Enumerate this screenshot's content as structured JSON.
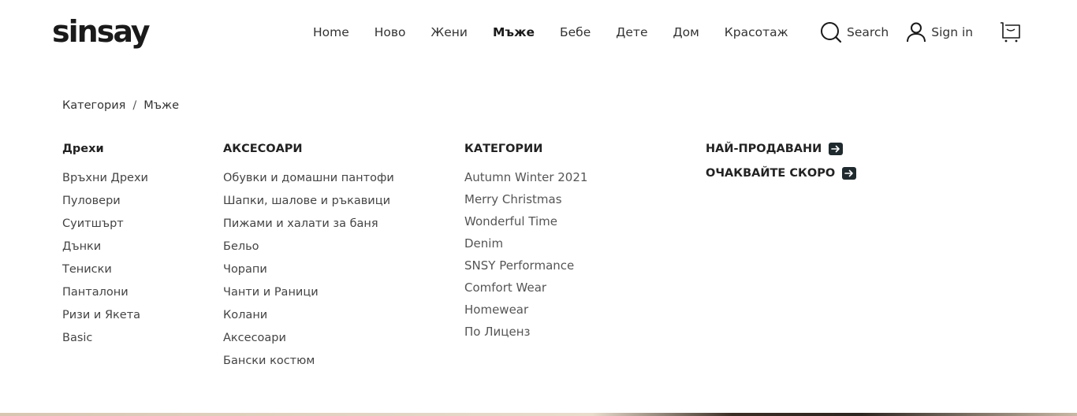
{
  "header": {
    "logo": "sinsay",
    "nav": [
      {
        "label": "Home",
        "active": false
      },
      {
        "label": "Ново",
        "active": false
      },
      {
        "label": "Жени",
        "active": false
      },
      {
        "label": "Мъже",
        "active": true
      },
      {
        "label": "Бебе",
        "active": false
      },
      {
        "label": "Дете",
        "active": false
      },
      {
        "label": "Дом",
        "active": false
      },
      {
        "label": "Красотаж",
        "active": false
      }
    ],
    "search_label": "Search",
    "signin_label": "Sign in"
  },
  "breadcrumb": {
    "root": "Категория",
    "separator": "/",
    "current": "Мъже"
  },
  "menu": {
    "clothes": {
      "title": "Дрехи",
      "items": [
        "Връхни Дрехи",
        "Пуловери",
        "Суитшърт",
        "Дънки",
        "Тениски",
        "Панталони",
        "Ризи и Якета",
        "Basic"
      ]
    },
    "accessories": {
      "title": "АКСЕСОАРИ",
      "items": [
        "Обувки и домашни пантофи",
        "Шапки, шалове и ръкавици",
        "Пижами и халати за баня",
        "Бельо",
        "Чорапи",
        "Чанти и Раници",
        "Колани",
        "Аксесоари",
        "Бански костюм"
      ]
    },
    "categories": {
      "title": "КАТЕГОРИИ",
      "items": [
        "Autumn Winter 2021",
        "Merry Christmas",
        "Wonderful Time",
        "Denim",
        "SNSY Performance",
        "Comfort Wear",
        "Homewear",
        "По Лиценз"
      ]
    },
    "promos": [
      "НАЙ-ПРОДАВАНИ",
      "ОЧАКВАЙТЕ СКОРО"
    ]
  },
  "colors": {
    "text": "#1a1a1a",
    "arrow_bg": "#1f2a2e"
  }
}
